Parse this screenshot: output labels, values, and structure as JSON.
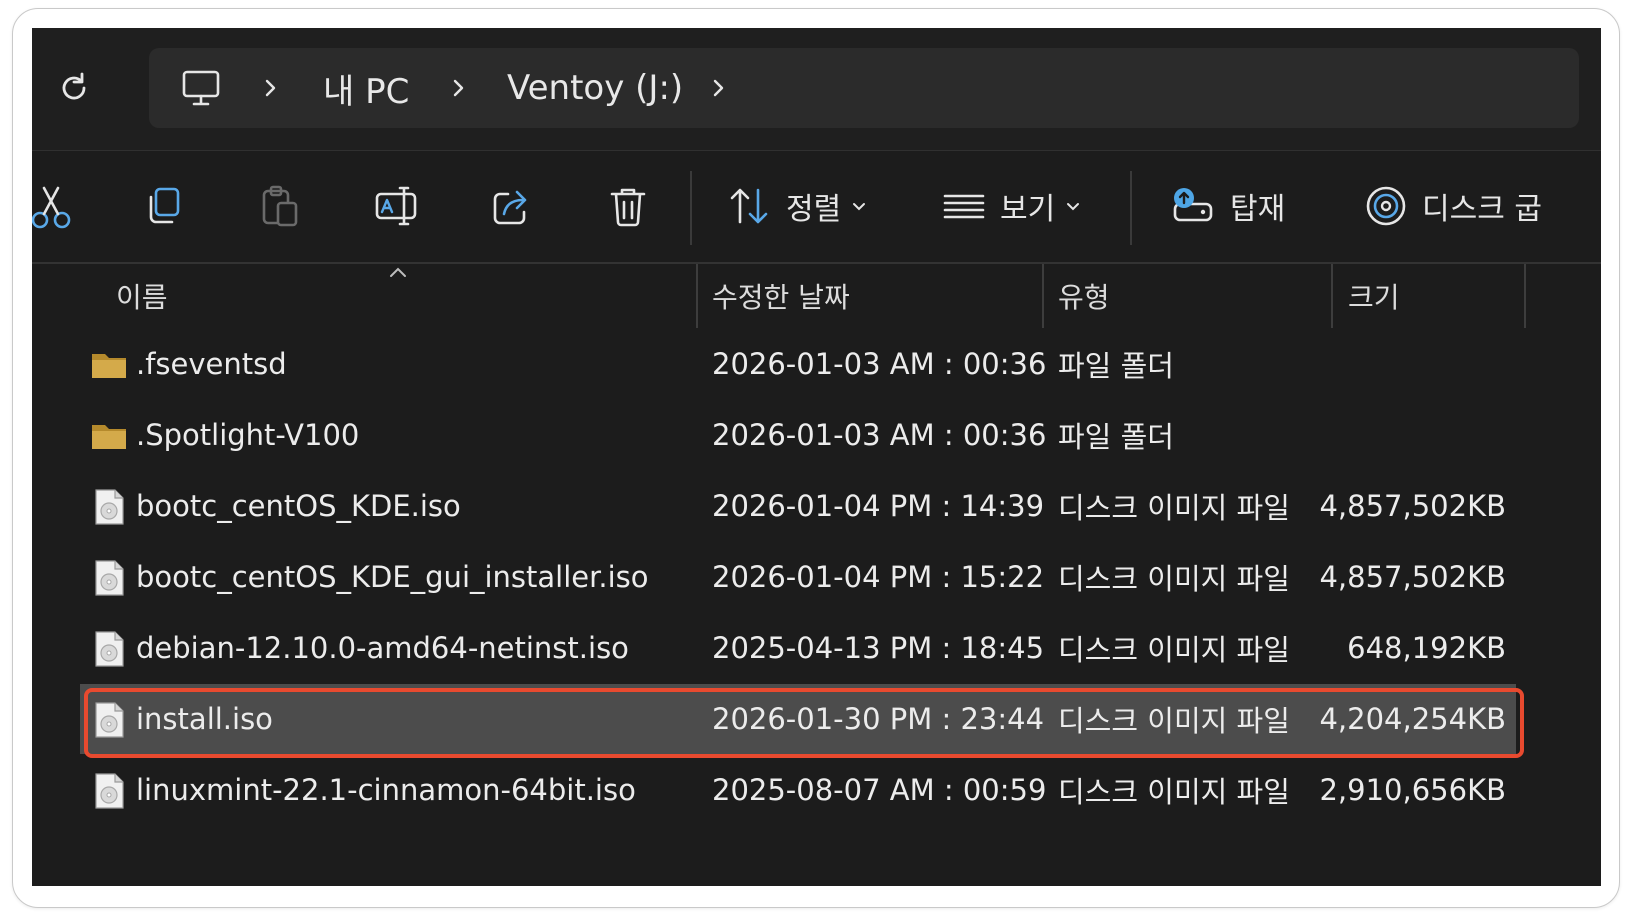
{
  "breadcrumb": {
    "items": [
      {
        "name": "breadcrumb-mypc",
        "label": "내 PC"
      },
      {
        "name": "breadcrumb-ventoy",
        "label": "Ventoy (J:)"
      }
    ]
  },
  "toolbar": {
    "sort_label": "정렬",
    "view_label": "보기",
    "mount_label": "탑재",
    "burn_label": "디스크 굽"
  },
  "columns": {
    "name": "이름",
    "modified": "수정한 날짜",
    "type": "유형",
    "size": "크기"
  },
  "files": [
    {
      "kind": "folder",
      "name": ".fseventsd",
      "modified": "2026-01-03 AM : 00:36",
      "type": "파일 폴더",
      "size": ""
    },
    {
      "kind": "folder",
      "name": ".Spotlight-V100",
      "modified": "2026-01-03 AM : 00:36",
      "type": "파일 폴더",
      "size": ""
    },
    {
      "kind": "iso",
      "name": "bootc_centOS_KDE.iso",
      "modified": "2026-01-04 PM : 14:39",
      "type": "디스크 이미지 파일",
      "size": "4,857,502KB"
    },
    {
      "kind": "iso",
      "name": "bootc_centOS_KDE_gui_installer.iso",
      "modified": "2026-01-04 PM : 15:22",
      "type": "디스크 이미지 파일",
      "size": "4,857,502KB"
    },
    {
      "kind": "iso",
      "name": "debian-12.10.0-amd64-netinst.iso",
      "modified": "2025-04-13 PM : 18:45",
      "type": "디스크 이미지 파일",
      "size": "648,192KB"
    },
    {
      "kind": "iso",
      "name": "install.iso",
      "modified": "2026-01-30 PM : 23:44",
      "type": "디스크 이미지 파일",
      "size": "4,204,254KB",
      "selected": true
    },
    {
      "kind": "iso",
      "name": "linuxmint-22.1-cinnamon-64bit.iso",
      "modified": "2025-08-07 AM : 00:59",
      "type": "디스크 이미지 파일",
      "size": "2,910,656KB"
    }
  ],
  "colors": {
    "background": "#1c1c1c",
    "selected_row": "#4c4c4c",
    "highlight_border": "#e84a2f",
    "folder": "#c9a13b",
    "mount_accent": "#4ea6e6"
  }
}
